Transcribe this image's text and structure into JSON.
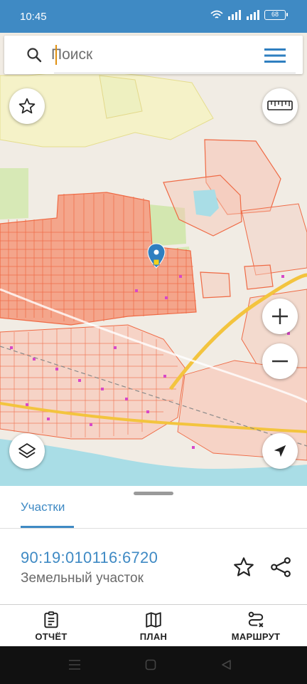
{
  "status_bar": {
    "time": "10:45",
    "battery": "68"
  },
  "search": {
    "placeholder": "Поиск"
  },
  "map": {
    "buttons": [
      "favorites-icon",
      "ruler-icon",
      "zoom-in-icon",
      "zoom-out-icon",
      "layers-icon",
      "locate-icon"
    ],
    "colors": {
      "parcel": "#ef6a45",
      "parcel_fill": "#f6c7b8",
      "water": "#a9dde6",
      "road": "#f3c43e",
      "green": "#d3e7b0"
    }
  },
  "sheet": {
    "tab": "Участки",
    "parcel": {
      "number": "90:19:010116:6720",
      "type": "Земельный участок"
    }
  },
  "bottom_nav": [
    {
      "label": "ОТЧЁТ",
      "icon": "report-icon"
    },
    {
      "label": "ПЛАН",
      "icon": "map-plan-icon"
    },
    {
      "label": "МАРШРУТ",
      "icon": "route-icon"
    }
  ],
  "accent": "#3f8ac4"
}
